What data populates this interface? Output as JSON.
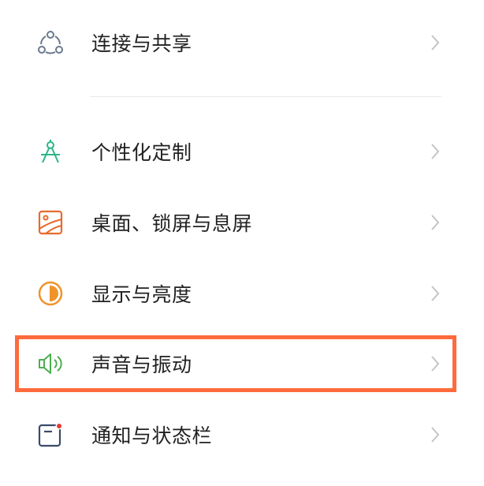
{
  "settings": {
    "items": [
      {
        "label": "连接与共享",
        "icon": "connect-share-icon",
        "color": "#6a7a8c"
      },
      {
        "label": "个性化定制",
        "icon": "compass-icon",
        "color": "#2bb58a"
      },
      {
        "label": "桌面、锁屏与息屏",
        "icon": "wallpaper-icon",
        "color": "#e86a2c"
      },
      {
        "label": "显示与亮度",
        "icon": "brightness-icon",
        "color": "#f0932b"
      },
      {
        "label": "声音与振动",
        "icon": "speaker-icon",
        "color": "#4caf50"
      },
      {
        "label": "通知与状态栏",
        "icon": "notification-icon",
        "color": "#3b4a6b"
      }
    ],
    "highlight_color": "#ff6a3d"
  }
}
